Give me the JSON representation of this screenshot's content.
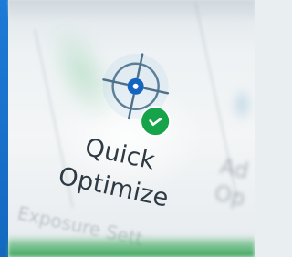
{
  "ribbon": {
    "quick_optimize": {
      "label_line1": "Quick",
      "label_line2": "Optimize",
      "icon": "crosshair-target-icon",
      "badge_icon": "checkmark-icon"
    },
    "next_tool": {
      "label_line1": "Ad",
      "label_line2": "Op"
    },
    "section_label": "Exposure Sett"
  },
  "colors": {
    "accent_blue": "#1d7ad6",
    "badge_green": "#16a34a",
    "target_blue": "#1565c0",
    "text": "#2e3a44"
  }
}
